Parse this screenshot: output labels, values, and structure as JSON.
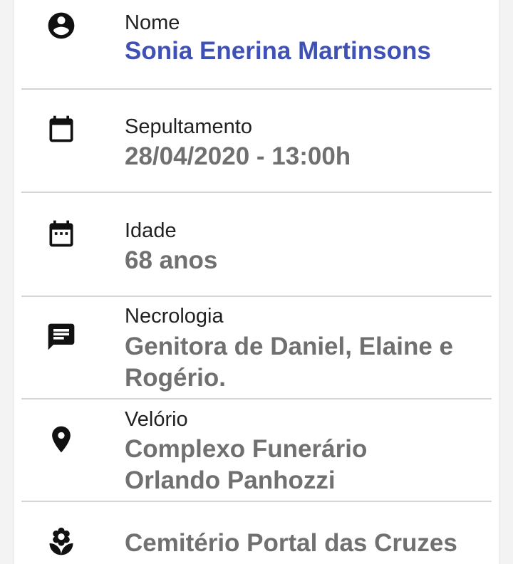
{
  "colors": {
    "accent": "#3f51b5",
    "value": "#707070",
    "label": "#212121",
    "icon": "#111111",
    "divider": "#d4d4d4"
  },
  "fields": [
    {
      "icon": "account-circle-icon",
      "label": "Nome",
      "value": "Sonia Enerina Martinsons"
    },
    {
      "icon": "calendar-icon",
      "label": "Sepultamento",
      "value": "28/04/2020 - 13:00h"
    },
    {
      "icon": "calendar-dots-icon",
      "label": "Idade",
      "value": "68 anos"
    },
    {
      "icon": "message-icon",
      "label": "Necrologia",
      "value": "Genitora de Daniel, Elaine e Rogério."
    },
    {
      "icon": "location-pin-icon",
      "label": "Velório",
      "value": "Complexo Funerário Orlando Panhozzi"
    },
    {
      "icon": "flower-icon",
      "value": "Cemitério Portal das Cruzes"
    }
  ]
}
